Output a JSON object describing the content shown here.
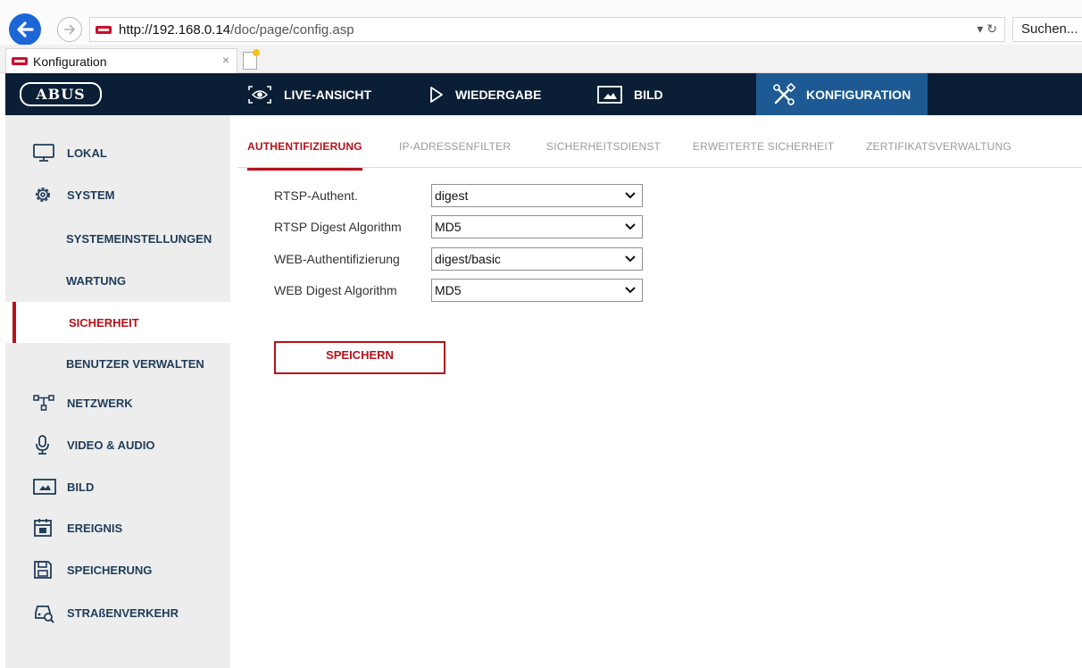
{
  "browser": {
    "url_host": "http://192.168.0.14",
    "url_path": "/doc/page/config.asp",
    "url_tools": "▾ ↻",
    "search_text": "Suchen...",
    "tab_title": "Konfiguration",
    "tab_close": "×"
  },
  "topnav": {
    "logo": "ABUS",
    "items": [
      {
        "label": "LIVE-ANSICHT",
        "icon": "eye-icon"
      },
      {
        "label": "WIEDERGABE",
        "icon": "play-icon"
      },
      {
        "label": "BILD",
        "icon": "image-icon"
      },
      {
        "label": "KONFIGURATION",
        "icon": "tools-icon"
      }
    ],
    "active_color": "#1d5a94",
    "background_color": "#0a1f35"
  },
  "sidebar": {
    "items": [
      {
        "label": "LOKAL",
        "icon": "monitor-icon"
      },
      {
        "label": "SYSTEM",
        "icon": "gear-icon"
      },
      {
        "label": "SYSTEMEINSTELLUNGEN"
      },
      {
        "label": "WARTUNG"
      },
      {
        "label": "SICHERHEIT"
      },
      {
        "label": "BENUTZER VERWALTEN"
      },
      {
        "label": "NETZWERK",
        "icon": "network-icon"
      },
      {
        "label": "VIDEO & AUDIO",
        "icon": "microphone-icon"
      },
      {
        "label": "BILD",
        "icon": "image-icon"
      },
      {
        "label": "EREIGNIS",
        "icon": "calendar-icon"
      },
      {
        "label": "SPEICHERUNG",
        "icon": "save-icon"
      },
      {
        "label": "STRAßENVERKEHR",
        "icon": "traffic-car-icon"
      }
    ],
    "active": "SICHERHEIT",
    "accent_color": "#b5121b"
  },
  "subtabs": [
    "AUTHENTIFIZIERUNG",
    "IP-ADRESSENFILTER",
    "SICHERHEITSDIENST",
    "ERWEITERTE SICHERHEIT",
    "ZERTIFIKATSVERWALTUNG"
  ],
  "form": {
    "fields": [
      {
        "label": "RTSP-Authent.",
        "value": "digest"
      },
      {
        "label": "RTSP Digest Algorithm",
        "value": "MD5"
      },
      {
        "label": "WEB-Authentifizierung",
        "value": "digest/basic"
      },
      {
        "label": "WEB Digest Algorithm",
        "value": "MD5"
      }
    ],
    "save_label": "SPEICHERN"
  }
}
